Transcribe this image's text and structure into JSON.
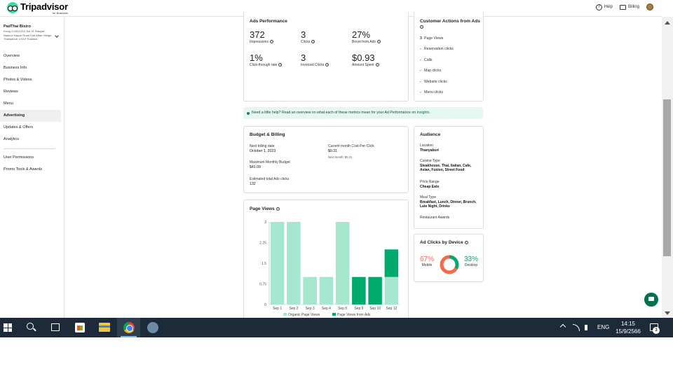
{
  "header": {
    "logo_text": "Tripadvisor",
    "logo_sub": "for Business",
    "help_label": "Help",
    "billing_label": "Billing"
  },
  "sidebar": {
    "business_name": "PadThai Bistro",
    "business_address": "Klong 9 200/1212 Soi 31 Rangsit, Nakhon Nayok Road Sub Affair Village, Thanyaburi 12110 Thailand",
    "items": [
      {
        "label": "Overview"
      },
      {
        "label": "Business Info"
      },
      {
        "label": "Photos & Videos"
      },
      {
        "label": "Reviews"
      },
      {
        "label": "Menu"
      },
      {
        "label": "Advertising"
      },
      {
        "label": "Updates & Offers"
      },
      {
        "label": "Analytics"
      },
      {
        "label": "User Permissions"
      },
      {
        "label": "Promo Tools & Awards"
      }
    ]
  },
  "ads_performance": {
    "title": "Ads Performance",
    "metrics": [
      {
        "value": "372",
        "label": "Impressions"
      },
      {
        "value": "3",
        "label": "Clicks"
      },
      {
        "value": "27%",
        "label": "Boost from Ads"
      },
      {
        "value": "1%",
        "label": "Click-through rate"
      },
      {
        "value": "3",
        "label": "Invoiced Clicks"
      },
      {
        "value": "$0.93",
        "label": "Amount Spent"
      }
    ]
  },
  "customer_actions": {
    "title": "Customer Actions from Ads",
    "items": [
      {
        "count": "3",
        "label": "Page Views"
      },
      {
        "count": "-",
        "label": "Reservation clicks"
      },
      {
        "count": "-",
        "label": "Calls"
      },
      {
        "count": "-",
        "label": "Map clicks"
      },
      {
        "count": "-",
        "label": "Website clicks"
      },
      {
        "count": "-",
        "label": "Menu clicks"
      }
    ]
  },
  "banner": {
    "text": "Need a little help? Read an overview on what each of these metrics mean for your Ad Performance on ",
    "link": "Insights."
  },
  "budget": {
    "title": "Budget & Billing",
    "next_billing_label": "Next billing date",
    "next_billing_value": "October 1, 2023",
    "cpc_label": "Current month Cost-Per-Click",
    "cpc_value": "$0.31",
    "cpc_next": "Next month: $0.31",
    "max_budget_label": "Maximum Monthly Budget",
    "max_budget_value": "$41.09",
    "est_clicks_label": "Estimated total Ads clicks",
    "est_clicks_value": "132"
  },
  "audience": {
    "title": "Audience",
    "fields": [
      {
        "label": "Location",
        "value": "Thanyaburi"
      },
      {
        "label": "Cuisine Type",
        "value": "Steakhouse, Thai, Italian, Cafe, Asian, Fusion, Street Food"
      },
      {
        "label": "Price Range",
        "value": "Cheap Eats"
      },
      {
        "label": "Meal Type",
        "value": "Breakfast, Lunch, Dinner, Brunch, Late Night, Drinks"
      },
      {
        "label": "Restaurant Awards",
        "value": ""
      }
    ]
  },
  "device": {
    "title": "Ad Clicks by Device",
    "mobile_pct": "67%",
    "mobile_label": "Mobile",
    "desktop_pct": "33%",
    "desktop_label": "Desktop",
    "mobile_color": "#f26b4f",
    "desktop_color": "#00aa6c"
  },
  "chart_data": {
    "type": "bar",
    "title": "Page Views",
    "categories": [
      "Sep 1",
      "Sep 2",
      "Sep 3",
      "Sep 4",
      "Sep 5",
      "Sep 9",
      "Sep 10",
      "Sep 12"
    ],
    "series": [
      {
        "name": "Organic Page Views",
        "values": [
          3,
          3,
          1,
          1,
          3,
          0,
          0,
          1
        ],
        "color": "#a5e6cf"
      },
      {
        "name": "Page Views from Ads",
        "values": [
          0,
          0,
          0,
          0,
          0,
          1,
          1,
          1
        ],
        "color": "#00aa6c"
      }
    ],
    "stacked": true,
    "yticks": [
      "0",
      "0.75",
      "1.5",
      "2.25",
      "3"
    ],
    "ylim": [
      0,
      3
    ],
    "legend_position": "bottom"
  },
  "taskbar": {
    "lang": "ENG",
    "time": "14:15",
    "date": "15/9/2566",
    "notif_count": "3"
  }
}
